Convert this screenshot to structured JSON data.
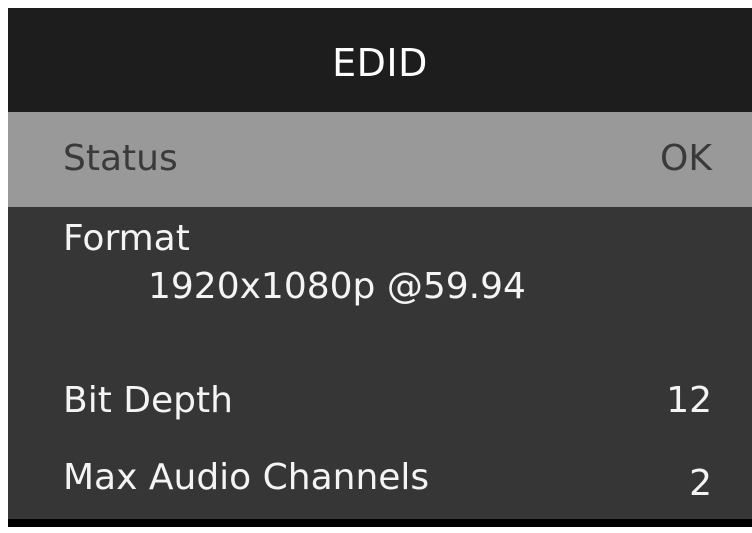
{
  "title": "EDID",
  "rows": {
    "status": {
      "label": "Status",
      "value": "OK"
    },
    "format": {
      "label": "Format",
      "value": "1920x1080p @59.94"
    },
    "bit_depth": {
      "label": "Bit Depth",
      "value": "12"
    },
    "max_audio_channels": {
      "label": "Max Audio Channels",
      "value": "2"
    }
  },
  "colors": {
    "title_bg": "#1d1d1d",
    "selected_bg": "#999999",
    "body_bg": "#363636",
    "text": "#f4f4f4"
  }
}
